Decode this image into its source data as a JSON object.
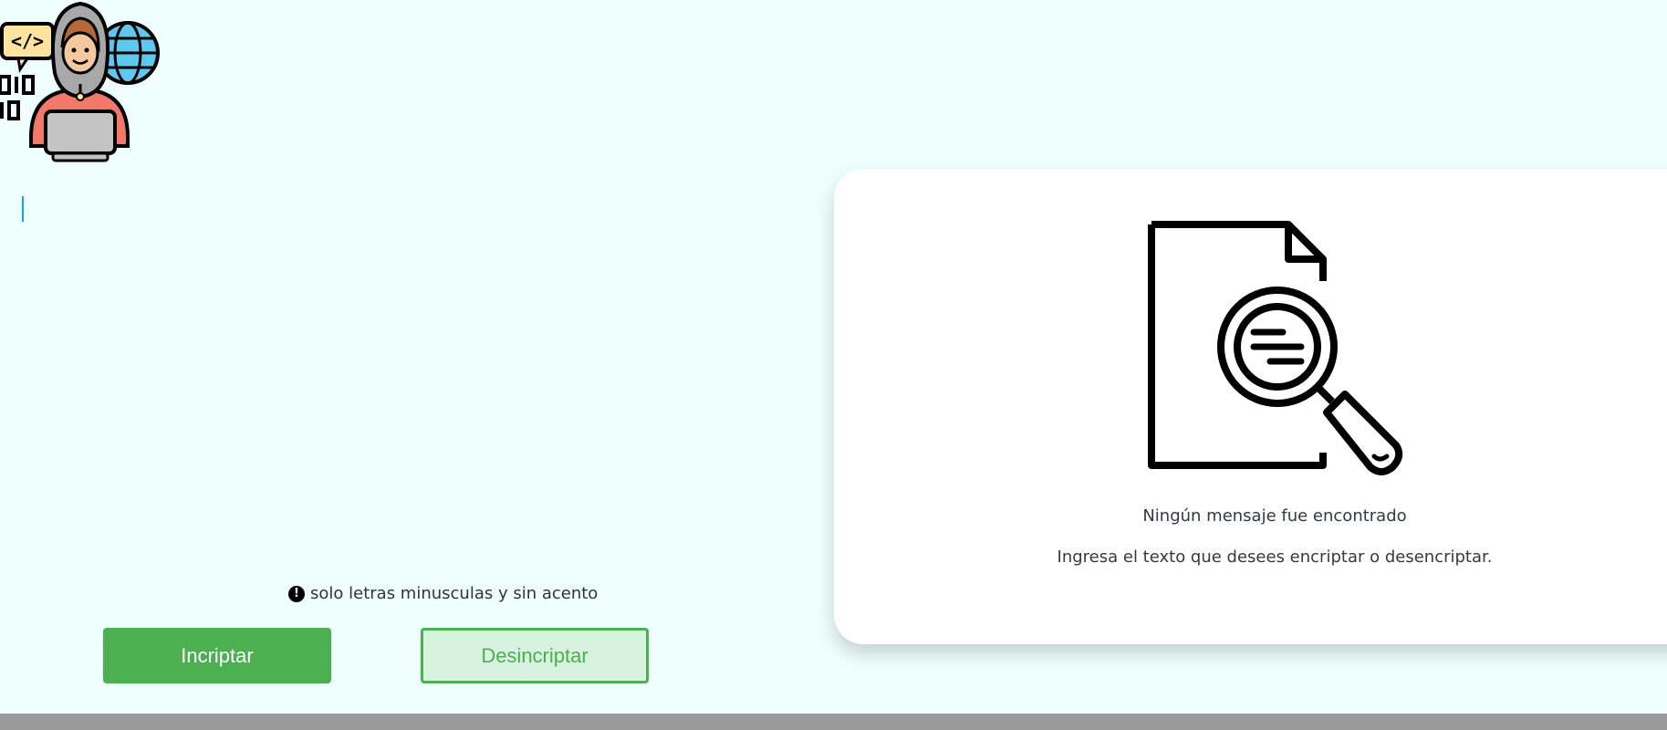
{
  "logo": {
    "icon": "hacker-developer-icon"
  },
  "input": {
    "value": "",
    "placeholder": ""
  },
  "hint": {
    "icon": "exclamation-circle-icon",
    "text": "solo letras minusculas y sin acento"
  },
  "buttons": {
    "encrypt_label": "Incriptar",
    "decrypt_label": "Desincriptar"
  },
  "result": {
    "icon": "document-search-icon",
    "title": "Ningún mensaje fue encontrado",
    "subtitle": "Ingresa el texto que desees encriptar o desencriptar."
  },
  "colors": {
    "background": "#effffe",
    "accent": "#4caf50",
    "secondary_bg": "#d7f2df",
    "footer": "#999999"
  }
}
